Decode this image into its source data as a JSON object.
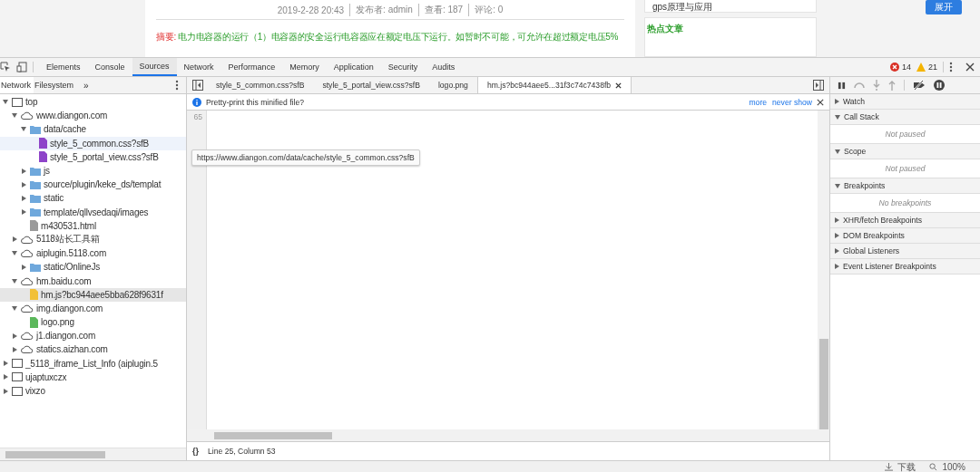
{
  "web_page": {
    "meta": [
      "2019-2-28 20:43",
      "发布者: admin",
      "查看: 187",
      "评论: 0"
    ],
    "summary_label": "摘要:",
    "summary": "电力电容器的运行（1）电容器的安全运行电容器应在额定电压下运行。如暂时不可能，可允许在超过额定电压5%",
    "sidebar_link": "gps原理与应用",
    "sidebar_heading": "热点文章",
    "float_button": "展开"
  },
  "devtools": {
    "tabs": [
      {
        "label": "Elements",
        "selected": false
      },
      {
        "label": "Console",
        "selected": false
      },
      {
        "label": "Sources",
        "selected": true
      },
      {
        "label": "Network",
        "selected": false
      },
      {
        "label": "Performance",
        "selected": false
      },
      {
        "label": "Memory",
        "selected": false
      },
      {
        "label": "Application",
        "selected": false
      },
      {
        "label": "Security",
        "selected": false
      },
      {
        "label": "Audits",
        "selected": false
      }
    ],
    "errors": "14",
    "warnings": "21",
    "navigator": {
      "tabs": [
        {
          "label": "Network",
          "selected": true
        },
        {
          "label": "Filesystem",
          "selected": false
        }
      ],
      "more": "»",
      "tree": [
        {
          "kind": "frame",
          "label": "top",
          "expanded": true,
          "selected": false,
          "children": [
            {
              "kind": "domain",
              "label": "www.diangon.com",
              "expanded": true,
              "selected": false,
              "children": [
                {
                  "kind": "folder",
                  "label": "data/cache",
                  "expanded": true,
                  "selected": false,
                  "children": [
                    {
                      "kind": "css",
                      "label": "style_5_common.css?sfB",
                      "selected": false,
                      "hovered": true
                    },
                    {
                      "kind": "css",
                      "label": "style_5_portal_view.css?sfB",
                      "selected": false
                    }
                  ]
                },
                {
                  "kind": "folder",
                  "label": "js",
                  "expanded": false,
                  "selected": false
                },
                {
                  "kind": "folder",
                  "label": "source/plugin/keke_ds/templat",
                  "expanded": false,
                  "selected": false
                },
                {
                  "kind": "folder",
                  "label": "static",
                  "expanded": false,
                  "selected": false
                },
                {
                  "kind": "folder",
                  "label": "template/qllvsedaqi/images",
                  "expanded": false,
                  "selected": false
                },
                {
                  "kind": "html",
                  "label": "m430531.html",
                  "selected": false
                }
              ]
            },
            {
              "kind": "domain",
              "label": "5118站长工具箱",
              "expanded": false,
              "selected": false
            },
            {
              "kind": "domain",
              "label": "aiplugin.5118.com",
              "expanded": true,
              "selected": false,
              "children": [
                {
                  "kind": "folder",
                  "label": "static/OnlineJs",
                  "expanded": false,
                  "selected": false
                }
              ]
            },
            {
              "kind": "domain",
              "label": "hm.baidu.com",
              "expanded": true,
              "selected": false,
              "children": [
                {
                  "kind": "js",
                  "label": "hm.js?bc944aee5bba628f9631f",
                  "selected": true
                }
              ]
            },
            {
              "kind": "domain",
              "label": "img.diangon.com",
              "expanded": true,
              "selected": false,
              "children": [
                {
                  "kind": "png",
                  "label": "logo.png",
                  "selected": false
                }
              ]
            },
            {
              "kind": "domain",
              "label": "j1.diangon.com",
              "expanded": false,
              "selected": false
            },
            {
              "kind": "domain",
              "label": "statics.aizhan.com",
              "expanded": false,
              "selected": false
            }
          ]
        },
        {
          "kind": "frame",
          "label": "_5118_iframe_List_Info (aiplugin.5",
          "expanded": false,
          "selected": false
        },
        {
          "kind": "frame",
          "label": "ujaptuxczx",
          "expanded": false,
          "selected": false
        },
        {
          "kind": "frame",
          "label": "vixzo",
          "expanded": false,
          "selected": false
        }
      ]
    },
    "editor": {
      "tabs": [
        {
          "label": "style_5_common.css?sfB",
          "selected": false
        },
        {
          "label": "style_5_portal_view.css?sfB",
          "selected": false
        },
        {
          "label": "logo.png",
          "selected": false
        },
        {
          "label": "hm.js?bc944aee5...31f3c74c7438fb",
          "selected": true,
          "closable": true
        }
      ],
      "infobar": {
        "message": "Pretty-print this minified file?",
        "links": [
          "more",
          "never show"
        ]
      },
      "line_number": "65",
      "tooltip": "https://www.diangon.com/data/cache/style_5_common.css?sfB",
      "format_button": "{}",
      "status": "Line 25, Column 53"
    },
    "debugger": {
      "sections": [
        {
          "title": "Watch",
          "expanded": false
        },
        {
          "title": "Call Stack",
          "expanded": true,
          "message": "Not paused"
        },
        {
          "title": "Scope",
          "expanded": true,
          "message": "Not paused"
        },
        {
          "title": "Breakpoints",
          "expanded": true,
          "message": "No breakpoints"
        },
        {
          "title": "XHR/fetch Breakpoints",
          "expanded": false
        },
        {
          "title": "DOM Breakpoints",
          "expanded": false
        },
        {
          "title": "Global Listeners",
          "expanded": false
        },
        {
          "title": "Event Listener Breakpoints",
          "expanded": false
        }
      ]
    }
  },
  "browser_status": {
    "download": "下载",
    "zoom": "100%"
  }
}
